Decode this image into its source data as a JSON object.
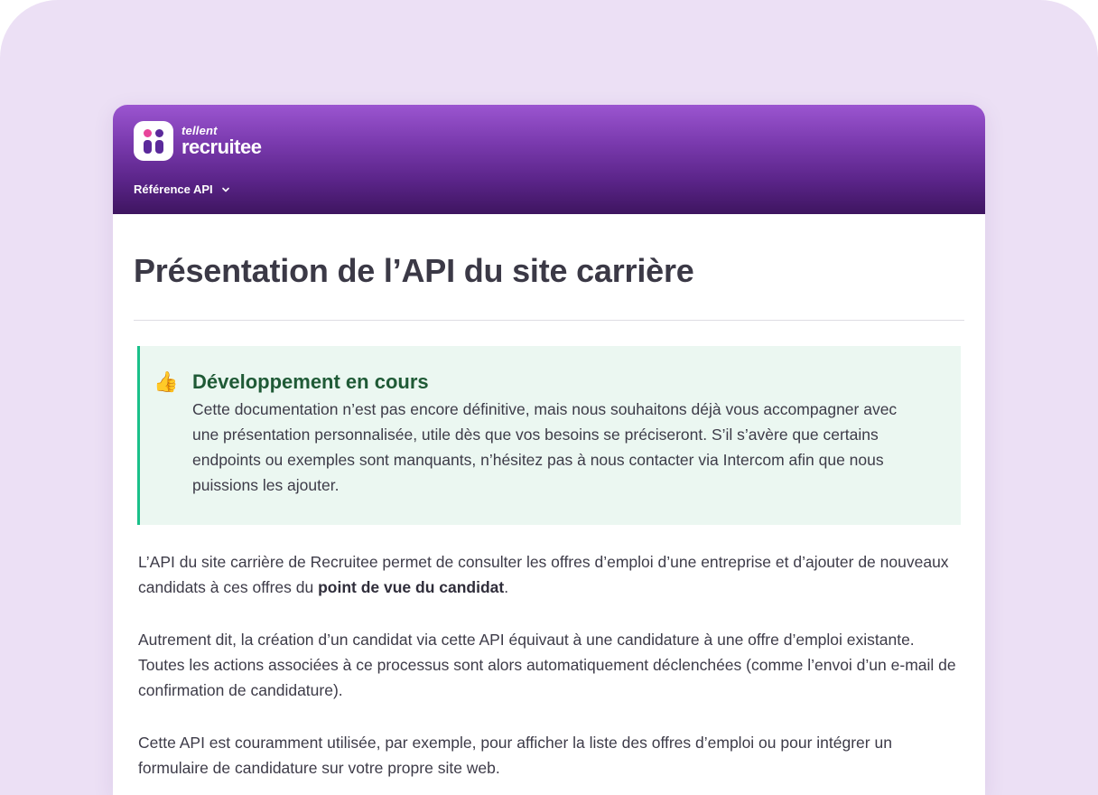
{
  "header": {
    "logo": {
      "brand": "tellent",
      "product": "recruitee"
    },
    "nav": {
      "label": "Référence API",
      "icon": "chevron-down-icon"
    },
    "colors": {
      "gradient_top": "#9b55d0",
      "gradient_bottom": "#3e1560"
    }
  },
  "page": {
    "title": "Présentation de l’API du site carrière"
  },
  "callout": {
    "icon": "thumbs-up-icon",
    "emoji": "👍",
    "title": "Développement en cours",
    "text": "Cette documentation n’est pas encore définitive, mais nous souhaitons déjà vous accompagner avec une présentation personnalisée, utile dès que vos besoins se préciseront. S’il s’avère que certains endpoints ou exemples sont manquants, n’hésitez pas à nous contacter via Intercom afin que nous puissions les ajouter.",
    "accent_color": "#19c08a"
  },
  "body": {
    "p1_text": "L’API du site carrière de Recruitee permet de consulter les offres d’emploi d’une entreprise et d’ajouter de nouveaux candidats à ces offres du ",
    "p1_bold": "point de vue du candidat",
    "p1_end": ".",
    "p2": "Autrement dit, la création d’un candidat via cette API équivaut à une candidature à une offre d’emploi existante. Toutes les actions associées à ce processus sont alors automatiquement déclenchées (comme l’envoi d’un e-mail de confirmation de candidature).",
    "p3": "Cette API est couramment utilisée, par exemple, pour afficher la liste des offres d’emploi ou pour intégrer un formulaire de candidature sur votre propre site web."
  }
}
